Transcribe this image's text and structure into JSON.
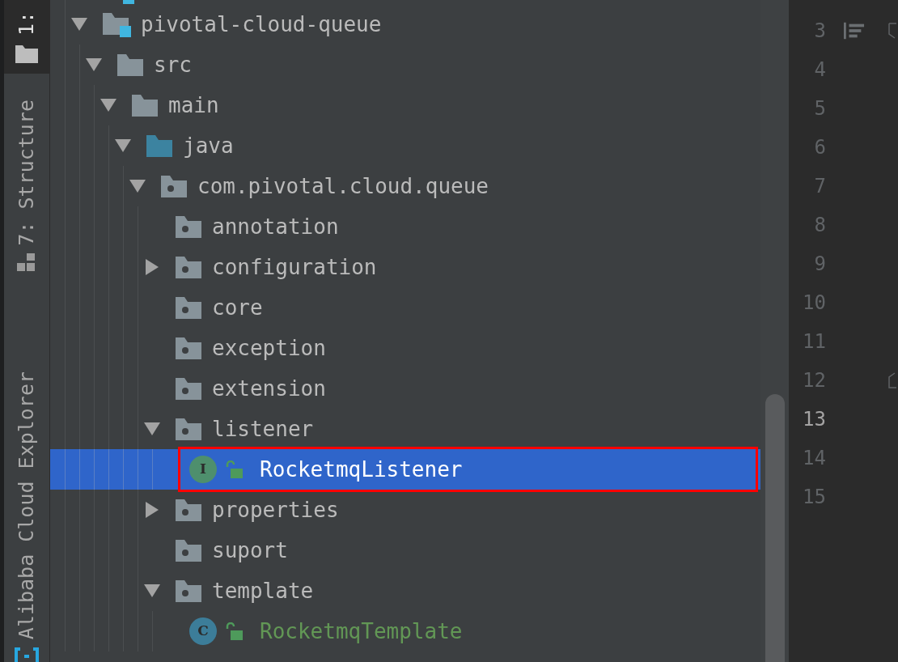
{
  "sidebar": {
    "tabs": [
      {
        "label": "1:",
        "kind": "project",
        "selected": true
      },
      {
        "label": "7: Structure",
        "kind": "structure",
        "selected": false
      },
      {
        "label": "Alibaba Cloud Explorer",
        "kind": "cloud",
        "selected": false
      }
    ]
  },
  "tree": [
    {
      "label": "pivotal-cloud-queue",
      "kind": "module",
      "expanded": true,
      "selected": false,
      "children": [
        {
          "label": "src",
          "kind": "folder",
          "expanded": true,
          "selected": false,
          "children": [
            {
              "label": "main",
              "kind": "folder",
              "expanded": true,
              "selected": false,
              "children": [
                {
                  "label": "java",
                  "kind": "source",
                  "expanded": true,
                  "selected": false,
                  "children": [
                    {
                      "label": "com.pivotal.cloud.queue",
                      "kind": "package",
                      "expanded": true,
                      "selected": false,
                      "children": [
                        {
                          "label": "annotation",
                          "kind": "package",
                          "selected": false
                        },
                        {
                          "label": "configuration",
                          "kind": "package",
                          "expanded": false,
                          "selected": false
                        },
                        {
                          "label": "core",
                          "kind": "package",
                          "selected": false
                        },
                        {
                          "label": "exception",
                          "kind": "package",
                          "selected": false
                        },
                        {
                          "label": "extension",
                          "kind": "package",
                          "selected": false
                        },
                        {
                          "label": "listener",
                          "kind": "package",
                          "expanded": true,
                          "selected": false,
                          "children": [
                            {
                              "label": "RocketmqListener",
                              "kind": "interface",
                              "badge": "I",
                              "selected": true
                            }
                          ]
                        },
                        {
                          "label": "properties",
                          "kind": "package",
                          "expanded": false,
                          "selected": false
                        },
                        {
                          "label": "suport",
                          "kind": "package",
                          "selected": false
                        },
                        {
                          "label": "template",
                          "kind": "package",
                          "expanded": true,
                          "selected": false,
                          "children": [
                            {
                              "label": "RocketmqTemplate",
                              "kind": "class",
                              "badge": "C",
                              "color": "#629755",
                              "selected": false
                            }
                          ]
                        }
                      ]
                    }
                  ]
                }
              ]
            }
          ]
        }
      ]
    }
  ],
  "gutter": {
    "lines": [
      {
        "number": "3",
        "current": false,
        "structure_marker": true,
        "fold_start": true
      },
      {
        "number": "4",
        "current": false
      },
      {
        "number": "5",
        "current": false
      },
      {
        "number": "6",
        "current": false
      },
      {
        "number": "7",
        "current": false
      },
      {
        "number": "8",
        "current": false
      },
      {
        "number": "9",
        "current": false
      },
      {
        "number": "10",
        "current": false
      },
      {
        "number": "11",
        "current": false
      },
      {
        "number": "12",
        "current": false,
        "fold_end": true
      },
      {
        "number": "13",
        "current": true
      },
      {
        "number": "14",
        "current": false
      },
      {
        "number": "15",
        "current": false
      }
    ]
  }
}
